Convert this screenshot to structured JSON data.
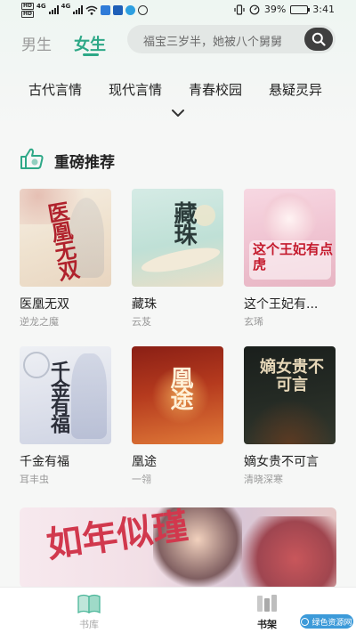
{
  "status_bar": {
    "hd1": "HD",
    "hd2": "HD",
    "net1": "4G",
    "net2": "4G",
    "battery_percent": "39%",
    "time": "3:41",
    "battery_level": 0.39
  },
  "header": {
    "tabs": [
      {
        "label": "男生",
        "active": false
      },
      {
        "label": "女生",
        "active": true
      }
    ],
    "search": {
      "placeholder": "福宝三岁半，她被八个舅舅",
      "icon": "search-icon"
    }
  },
  "categories": [
    "古代言情",
    "现代言情",
    "青春校园",
    "悬疑灵异"
  ],
  "section": {
    "title": "重磅推荐",
    "icon": "thumbs-up-icon"
  },
  "books": [
    {
      "title": "医凰无双",
      "author": "逆龙之魔",
      "cover_text": "医凰无双"
    },
    {
      "title": "藏珠",
      "author": "云芨",
      "cover_text": "藏珠"
    },
    {
      "title": "这个王妃有...",
      "author": "玄琋",
      "cover_text": "这个王妃有点虎"
    },
    {
      "title": "千金有福",
      "author": "耳丰虫",
      "cover_text": "千金有福"
    },
    {
      "title": "凰途",
      "author": "一翎",
      "cover_text": "凰途"
    },
    {
      "title": "嫡女贵不可言",
      "author": "清晓深寒",
      "cover_text": "嫡女贵不可言"
    }
  ],
  "banner": {
    "text": "如年似瑾"
  },
  "bottom_nav": [
    {
      "label": "书库",
      "icon": "book-open-icon",
      "active": false
    },
    {
      "label": "书架",
      "icon": "bookshelf-icon",
      "active": true
    }
  ],
  "watermark": "绿色资源网",
  "colors": {
    "accent": "#2ea887",
    "text": "#222222",
    "muted": "#999999"
  }
}
